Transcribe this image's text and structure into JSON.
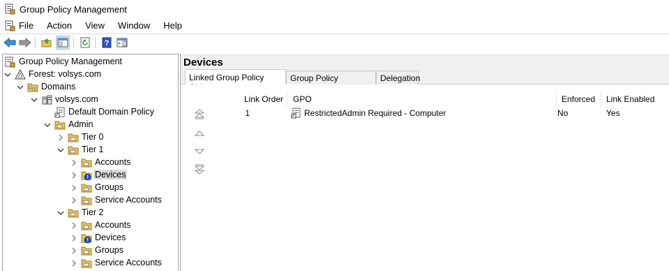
{
  "window": {
    "title": "Group Policy Management"
  },
  "menu": [
    "File",
    "Action",
    "View",
    "Window",
    "Help"
  ],
  "toolbar": [
    {
      "name": "back-icon"
    },
    {
      "name": "forward-icon"
    },
    {
      "name": "up-folder-icon"
    },
    {
      "name": "show-hide-tree-icon"
    },
    {
      "name": "refresh-icon"
    },
    {
      "name": "help-icon"
    },
    {
      "name": "action-pane-icon"
    }
  ],
  "tree": [
    {
      "label": "Group Policy Management",
      "level": 0,
      "icon": "gpm-icon",
      "chev": "none"
    },
    {
      "label": "Forest: volsys.com",
      "level": 0,
      "icon": "forest-icon",
      "chev": "down"
    },
    {
      "label": "Domains",
      "level": 1,
      "icon": "folder-icon",
      "chev": "down"
    },
    {
      "label": "volsys.com",
      "level": 2,
      "icon": "domain-icon",
      "chev": "down"
    },
    {
      "label": "Default Domain Policy",
      "level": 3,
      "icon": "gpo-link-icon",
      "chev": "none"
    },
    {
      "label": "Admin",
      "level": 3,
      "icon": "ou-icon",
      "chev": "down"
    },
    {
      "label": "Tier 0",
      "level": 4,
      "icon": "ou-icon",
      "chev": "right"
    },
    {
      "label": "Tier 1",
      "level": 4,
      "icon": "ou-icon",
      "chev": "down"
    },
    {
      "label": "Accounts",
      "level": 5,
      "icon": "ou-icon",
      "chev": "right"
    },
    {
      "label": "Devices",
      "level": 5,
      "icon": "ou-warning-icon",
      "chev": "right",
      "selected": true
    },
    {
      "label": "Groups",
      "level": 5,
      "icon": "ou-icon",
      "chev": "right"
    },
    {
      "label": "Service Accounts",
      "level": 5,
      "icon": "ou-icon",
      "chev": "right"
    },
    {
      "label": "Tier 2",
      "level": 4,
      "icon": "ou-icon",
      "chev": "down"
    },
    {
      "label": "Accounts",
      "level": 5,
      "icon": "ou-icon",
      "chev": "right"
    },
    {
      "label": "Devices",
      "level": 5,
      "icon": "ou-warning-icon",
      "chev": "right"
    },
    {
      "label": "Groups",
      "level": 5,
      "icon": "ou-icon",
      "chev": "right"
    },
    {
      "label": "Service Accounts",
      "level": 5,
      "icon": "ou-icon",
      "chev": "right"
    }
  ],
  "pane": {
    "title": "Devices",
    "tabs": [
      "Linked Group Policy Objects",
      "Group Policy Inheritance",
      "Delegation"
    ],
    "columns": [
      "Link Order",
      "GPO",
      "Enforced",
      "Link Enabled"
    ],
    "rows": [
      {
        "order": "1",
        "gpo": "RestrictedAdmin Required - Computer",
        "enforced": "No",
        "enabled": "Yes"
      }
    ]
  },
  "colors": {
    "selection": "#d9d9d9",
    "pane_header": "#f0f0f0",
    "folder": "#e8c45a",
    "warning": "#1f4fd1"
  }
}
